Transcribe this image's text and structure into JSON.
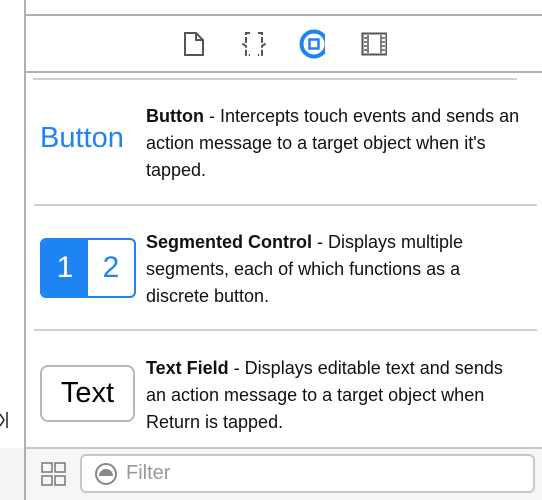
{
  "inspector_tabs": [
    {
      "name": "file-inspector",
      "icon": "document-icon",
      "active": false
    },
    {
      "name": "quick-help",
      "icon": "braces-icon",
      "active": false
    },
    {
      "name": "object-library",
      "icon": "object-circle-icon",
      "active": true
    },
    {
      "name": "media-library",
      "icon": "film-strip-icon",
      "active": false
    }
  ],
  "accent_color": "#1d84f2",
  "library_items": [
    {
      "preview": "Button",
      "title": "Button",
      "description": " - Intercepts touch events and sends an action message to a target object when it's tapped."
    },
    {
      "preview_segments": [
        "1",
        "2"
      ],
      "title": "Segmented Control",
      "description": " - Displays multiple segments, each of which functions as a discrete button."
    },
    {
      "preview": "Text",
      "title": "Text Field",
      "description": " - Displays editable text and sends an action message to a target object when Return is tapped."
    }
  ],
  "filter": {
    "placeholder": "Filter",
    "value": ""
  }
}
